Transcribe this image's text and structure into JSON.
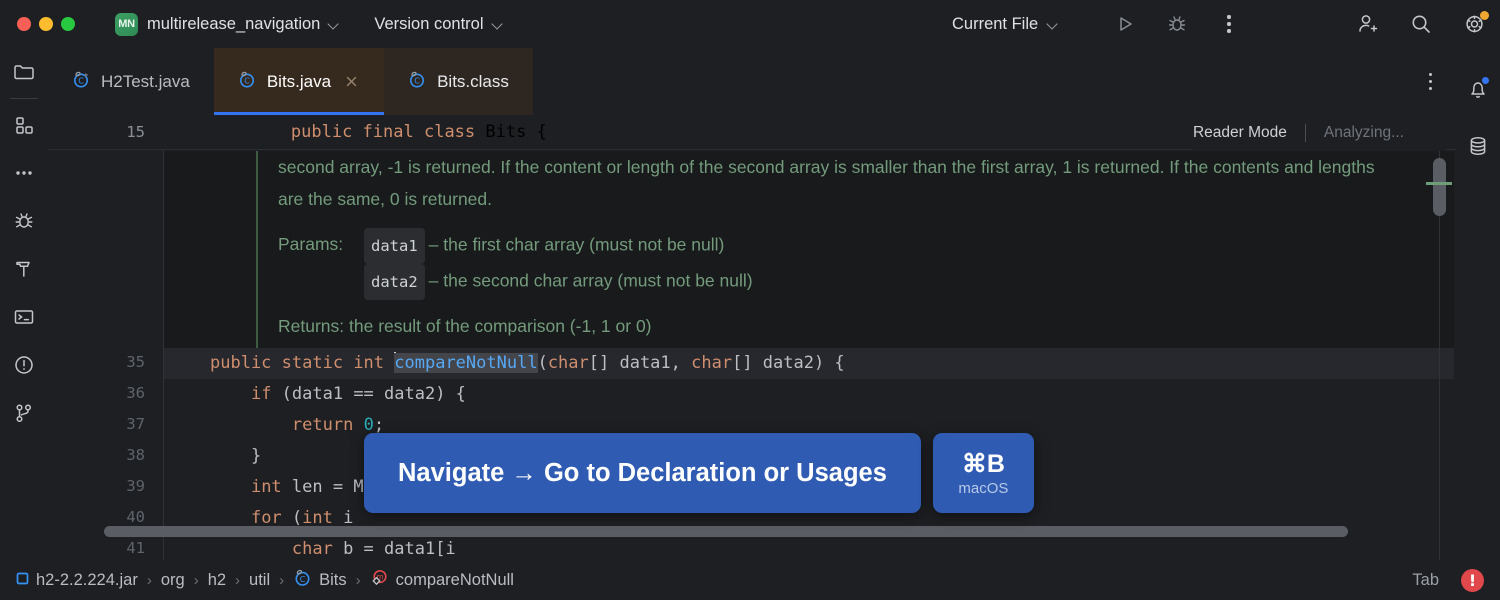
{
  "titlebar": {
    "project_initials": "MN",
    "project_name": "multirelease_navigation",
    "vcs_label": "Version control",
    "run_config": "Current File",
    "icons": {
      "run": "run-icon",
      "debug": "debug-icon",
      "more": "more-options-icon",
      "add_user": "add-user-icon",
      "search": "search-icon",
      "settings": "settings-icon"
    }
  },
  "left_toolbar": {
    "items": [
      {
        "name": "project-tool-window",
        "icon": "folder-icon"
      },
      {
        "name": "structure-tool-window",
        "icon": "structure-icon"
      },
      {
        "name": "more-tool-windows",
        "icon": "ellipsis-icon"
      },
      {
        "name": "debug-tool-window",
        "icon": "bug-icon"
      },
      {
        "name": "build-tool-window",
        "icon": "hammer-icon"
      },
      {
        "name": "terminal-tool-window",
        "icon": "terminal-icon"
      },
      {
        "name": "problems-tool-window",
        "icon": "warning-circle-icon"
      },
      {
        "name": "version-control-tool-window",
        "icon": "branch-icon"
      }
    ]
  },
  "right_toolbar": {
    "items": [
      {
        "name": "notifications",
        "icon": "bell-icon",
        "has_badge": true
      },
      {
        "name": "database-tool-window",
        "icon": "database-icon",
        "has_badge": false
      }
    ]
  },
  "tabs": [
    {
      "label": "H2Test.java",
      "icon": "java-test-class-icon",
      "state": "inactive",
      "closable": false
    },
    {
      "label": "Bits.java",
      "icon": "java-class-icon",
      "state": "active",
      "closable": true
    },
    {
      "label": "Bits.class",
      "icon": "java-class-icon",
      "state": "inactive",
      "closable": false
    }
  ],
  "editor": {
    "reader_mode": "Reader Mode",
    "analyzing": "Analyzing...",
    "sticky_line": {
      "number": "15",
      "tokens": [
        {
          "t": "public ",
          "c": "kw"
        },
        {
          "t": "final ",
          "c": "kw"
        },
        {
          "t": "class ",
          "c": "kw"
        },
        {
          "t": "Bits {",
          "c": "plain"
        }
      ]
    },
    "javadoc": {
      "paragraph": "second array, -1 is returned. If the content or length of the second array is smaller than the first array, 1 is returned. If the contents and lengths are the same, 0 is returned.",
      "params_label": "Params:",
      "params": [
        {
          "name": "data1",
          "desc": "– the first char array (must not be null)"
        },
        {
          "name": "data2",
          "desc": "– the second char array (must not be null)"
        }
      ],
      "returns": "Returns: the result of the comparison (-1, 1 or 0)"
    },
    "line_numbers": [
      "36",
      "37",
      "38",
      "39",
      "40",
      "41"
    ],
    "code_lines": [
      {
        "n": "35",
        "caret": true,
        "tokens": [
          {
            "t": "public ",
            "c": "kw"
          },
          {
            "t": "static ",
            "c": "kw"
          },
          {
            "t": "int ",
            "c": "kw"
          },
          {
            "t": "compareNotNull",
            "c": "id-sel"
          },
          {
            "t": "(",
            "c": "plain"
          },
          {
            "t": "char",
            "c": "kw"
          },
          {
            "t": "[] data1, ",
            "c": "plain"
          },
          {
            "t": "char",
            "c": "kw"
          },
          {
            "t": "[] data2) {",
            "c": "plain"
          }
        ]
      },
      {
        "n": "36",
        "caret": false,
        "tokens": [
          {
            "t": "    ",
            "c": "plain"
          },
          {
            "t": "if",
            "c": "kw"
          },
          {
            "t": " (data1 == data2) {",
            "c": "plain"
          }
        ]
      },
      {
        "n": "37",
        "caret": false,
        "tokens": [
          {
            "t": "        ",
            "c": "plain"
          },
          {
            "t": "return",
            "c": "kw"
          },
          {
            "t": " ",
            "c": "plain"
          },
          {
            "t": "0",
            "c": "num"
          },
          {
            "t": ";",
            "c": "plain"
          }
        ]
      },
      {
        "n": "38",
        "caret": false,
        "tokens": [
          {
            "t": "    }",
            "c": "plain"
          }
        ]
      },
      {
        "n": "39",
        "caret": false,
        "tokens": [
          {
            "t": "    ",
            "c": "plain"
          },
          {
            "t": "int",
            "c": "kw"
          },
          {
            "t": " len = M",
            "c": "plain"
          }
        ]
      },
      {
        "n": "40",
        "caret": false,
        "tokens": [
          {
            "t": "    ",
            "c": "plain"
          },
          {
            "t": "for",
            "c": "kw"
          },
          {
            "t": " (",
            "c": "plain"
          },
          {
            "t": "int",
            "c": "kw"
          },
          {
            "t": " i",
            "c": "plain"
          }
        ]
      },
      {
        "n": "41",
        "caret": false,
        "tokens": [
          {
            "t": "        ",
            "c": "plain"
          },
          {
            "t": "char",
            "c": "kw"
          },
          {
            "t": " b = data1[i",
            "c": "plain"
          }
        ]
      }
    ]
  },
  "popup": {
    "action": "Navigate → Go to Declaration or Usages",
    "shortcut": "⌘B",
    "os": "macOS",
    "accent": "#2f5bb2"
  },
  "statusbar": {
    "breadcrumbs": [
      {
        "label": "h2-2.2.224.jar",
        "icon": "jar-icon"
      },
      {
        "label": "org",
        "icon": ""
      },
      {
        "label": "h2",
        "icon": ""
      },
      {
        "label": "util",
        "icon": ""
      },
      {
        "label": "Bits",
        "icon": "java-class-icon"
      },
      {
        "label": "compareNotNull",
        "icon": "method-icon"
      }
    ],
    "separator": "›",
    "indent_mode": "Tab",
    "error_badge": "!"
  }
}
